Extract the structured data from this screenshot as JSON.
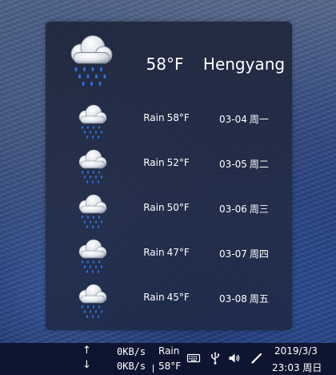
{
  "weather": {
    "current": {
      "temperature": "58°F",
      "city": "Hengyang",
      "icon": "rain-cloud-icon"
    },
    "forecast": [
      {
        "condition": "Rain",
        "temperature": "58°F",
        "date": "03-04",
        "weekday": "周一",
        "icon": "rain-cloud-icon"
      },
      {
        "condition": "Rain",
        "temperature": "52°F",
        "date": "03-05",
        "weekday": "周二",
        "icon": "rain-cloud-icon"
      },
      {
        "condition": "Rain",
        "temperature": "50°F",
        "date": "03-06",
        "weekday": "周三",
        "icon": "rain-cloud-icon"
      },
      {
        "condition": "Rain",
        "temperature": "47°F",
        "date": "03-07",
        "weekday": "周四",
        "icon": "rain-cloud-icon"
      },
      {
        "condition": "Rain",
        "temperature": "45°F",
        "date": "03-08",
        "weekday": "周五",
        "icon": "rain-cloud-icon"
      }
    ]
  },
  "taskbar": {
    "network": {
      "upload_arrow": "↑",
      "download_arrow": "↓",
      "upload_speed": "0KB/s",
      "download_speed": "0KB/s"
    },
    "weather": {
      "condition": "Rain",
      "temperature": "58°F"
    },
    "tray_icons": [
      "keyboard-icon",
      "usb-icon",
      "volume-icon",
      "pen-icon"
    ],
    "clock": {
      "date": "2019/3/3",
      "time": "23:03",
      "weekday": "周日"
    }
  }
}
